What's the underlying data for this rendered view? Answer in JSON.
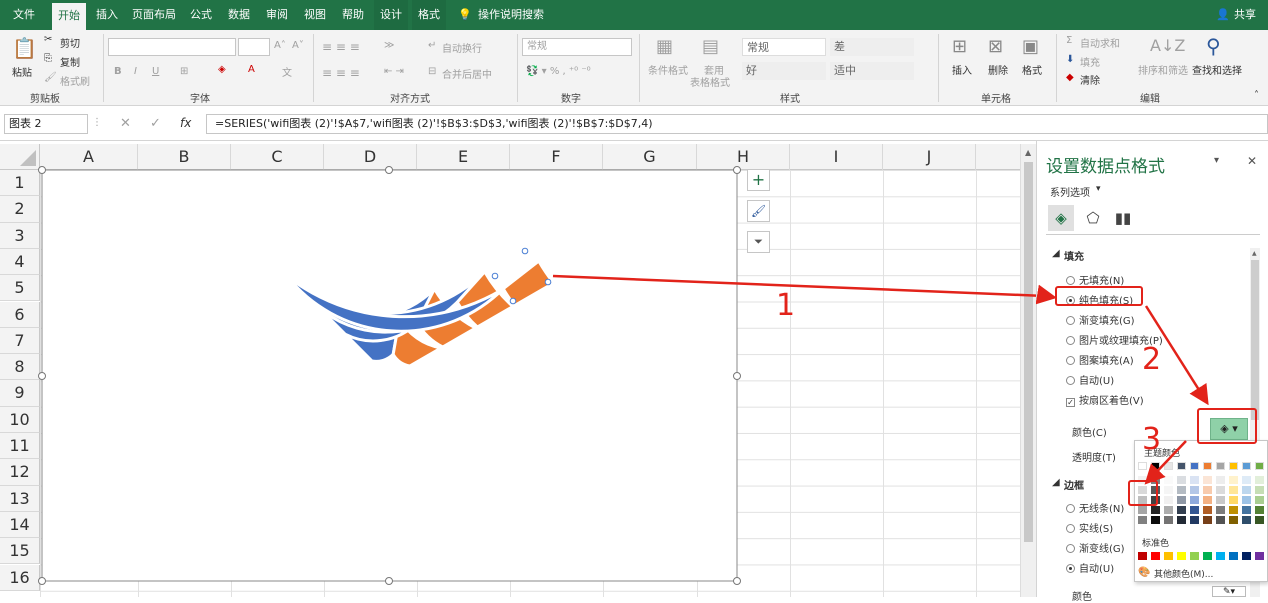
{
  "tabs": [
    "文件",
    "开始",
    "插入",
    "页面布局",
    "公式",
    "数据",
    "审阅",
    "视图",
    "帮助",
    "设计",
    "格式"
  ],
  "tellme": "操作说明搜索",
  "share": "共享",
  "ribbon": {
    "clipboard": {
      "paste": "粘贴",
      "cut": "剪切",
      "copy": "复制",
      "format_painter": "格式刷",
      "label": "剪贴板"
    },
    "font": {
      "label": "字体"
    },
    "alignment": {
      "wrap": "自动换行",
      "merge": "合并后居中",
      "label": "对齐方式"
    },
    "number": {
      "format": "常规",
      "label": "数字"
    },
    "styles": {
      "cond": "条件格式",
      "table1": "套用",
      "table2": "表格格式",
      "normal": "常规",
      "bad": "差",
      "good": "好",
      "neutral": "适中",
      "label": "样式"
    },
    "cells": {
      "insert": "插入",
      "delete": "删除",
      "format": "格式",
      "label": "单元格"
    },
    "editing": {
      "autosum": "自动求和",
      "fill": "填充",
      "clear": "清除",
      "sort": "排序和筛选",
      "find": "查找和选择",
      "label": "编辑"
    }
  },
  "formula_bar": {
    "name_box": "图表 2",
    "fx": "fx",
    "formula": "=SERIES('wifi图表 (2)'!$A$7,'wifi图表 (2)'!$B$3:$D$3,'wifi图表 (2)'!$B$7:$D$7,4)"
  },
  "columns": [
    "A",
    "B",
    "C",
    "D",
    "E",
    "F",
    "G",
    "H",
    "I",
    "J"
  ],
  "rows": [
    "1",
    "2",
    "3",
    "4",
    "5",
    "6",
    "7",
    "8",
    "9",
    "10",
    "11",
    "12",
    "13",
    "14",
    "15",
    "16"
  ],
  "chart_buttons": [
    "+",
    "brush",
    "filter"
  ],
  "panel": {
    "title": "设置数据点格式",
    "series_options": "系列选项",
    "fill_header": "填充",
    "fill_options": [
      "无填充(N)",
      "纯色填充(S)",
      "渐变填充(G)",
      "图片或纹理填充(P)",
      "图案填充(A)",
      "自动(U)"
    ],
    "vary_color": "按扇区着色(V)",
    "color_label": "颜色(C)",
    "transparency_label": "透明度(T)",
    "border_header": "边框",
    "border_options": [
      "无线条(N)",
      "实线(S)",
      "渐变线(G)",
      "自动(U)"
    ],
    "border_color": "颜色"
  },
  "palette": {
    "theme_label": "主题颜色",
    "standard_label": "标准色",
    "more": "其他颜色(M)...",
    "theme_top": [
      "#ffffff",
      "#000000",
      "#e7e6e6",
      "#44546a",
      "#4472c4",
      "#ed7d31",
      "#a5a5a5",
      "#ffc000",
      "#5b9bd5",
      "#70ad47"
    ],
    "standard": [
      "#c00000",
      "#ff0000",
      "#ffc000",
      "#ffff00",
      "#92d050",
      "#00b050",
      "#00b0f0",
      "#0070c0",
      "#002060",
      "#7030a0"
    ]
  },
  "annotations": [
    "1",
    "2",
    "3"
  ],
  "colors": {
    "blue": "#4472c4",
    "orange": "#ed7d31",
    "accent": "#217346",
    "red": "#e2231a"
  }
}
